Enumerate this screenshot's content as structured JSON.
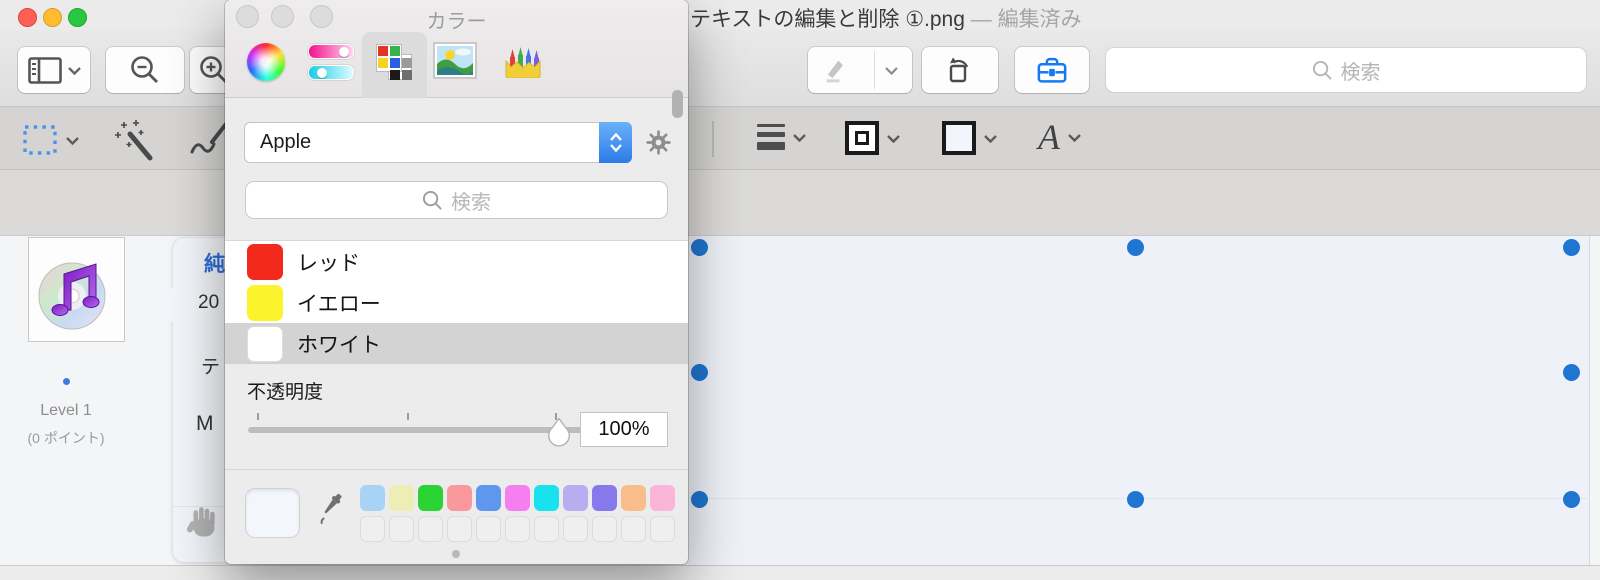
{
  "window": {
    "title": "テキストの編集と削除 ①.png",
    "separator": " — ",
    "status": "編集済み"
  },
  "toolbar": {
    "search_placeholder": "検索"
  },
  "markup_toolbar": {
    "text_style_label": "A"
  },
  "color_panel": {
    "title": "カラー",
    "palette_selector_value": "Apple",
    "search_placeholder": "検索",
    "color_list": [
      {
        "name": "レッド",
        "hex": "#f3291b",
        "selected": false
      },
      {
        "name": "イエロー",
        "hex": "#fbf32b",
        "selected": false
      },
      {
        "name": "ホワイト",
        "hex": "#ffffff",
        "selected": true
      }
    ],
    "opacity_label": "不透明度",
    "opacity_value": "100%",
    "swatches": [
      "#a9d3f5",
      "#efedb6",
      "#2bd335",
      "#f9999c",
      "#5f97ee",
      "#f57ef1",
      "#19e2ee",
      "#b6aef1",
      "#8779ec",
      "#f9bd8c",
      "#fbb5d8"
    ],
    "accent_blue": "#2c7ce8",
    "selected_row_gray": "#d3d3d3"
  },
  "document": {
    "level_label": "Level 1",
    "points_label": "(0 ポイント)",
    "callout_lines": [
      "純",
      "20",
      "テ",
      "M"
    ],
    "handle_color": "#1f76d2"
  }
}
